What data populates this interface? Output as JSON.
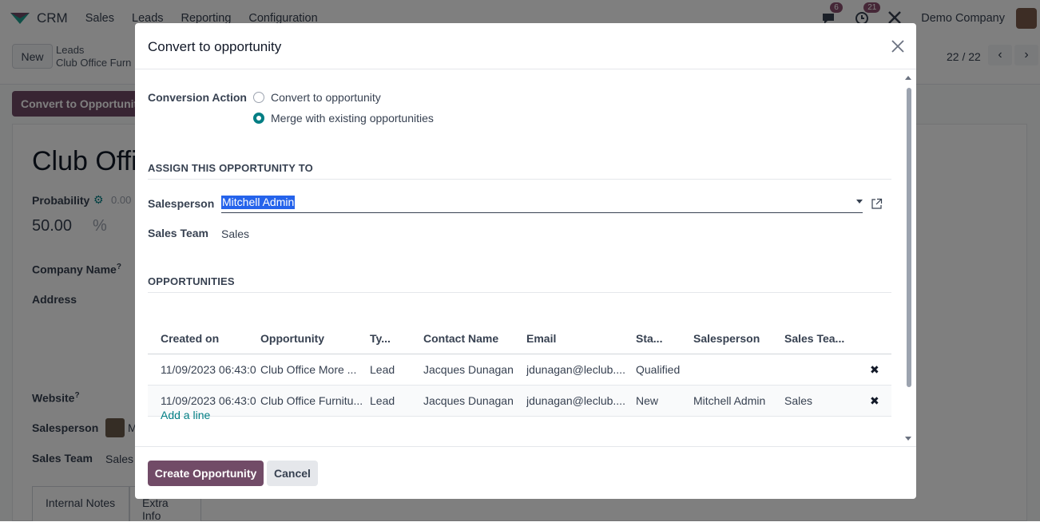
{
  "nav": {
    "app_name": "CRM",
    "menu": [
      "Sales",
      "Leads",
      "Reporting",
      "Configuration"
    ],
    "messages_count": "6",
    "activities_count": "21",
    "company": "Demo Company"
  },
  "control_panel": {
    "new_label": "New",
    "breadcrumb_parent": "Leads",
    "breadcrumb_current": "Club Office Furn",
    "pager": "22 / 22"
  },
  "form": {
    "convert_button": "Convert to Opportunit",
    "title": "Club Offi",
    "probability_label": "Probability",
    "probability_auto": "0.00",
    "probability_value": "50.00",
    "probability_unit": "%",
    "company_name_label": "Company Name",
    "address_label": "Address",
    "website_label": "Website",
    "help_mark": "?",
    "salesperson_label": "Salesperson",
    "salesperson_initial": "M",
    "sales_team_label": "Sales Team",
    "sales_team_value": "Sales",
    "tabs": [
      "Internal Notes",
      "Extra Info"
    ]
  },
  "dialog": {
    "title": "Convert to opportunity",
    "conversion_action_label": "Conversion Action",
    "options": [
      "Convert to opportunity",
      "Merge with existing opportunities"
    ],
    "selected_option": "Merge with existing opportunities",
    "assign_section": "ASSIGN THIS OPPORTUNITY TO",
    "salesperson_label": "Salesperson",
    "salesperson_value": "Mitchell Admin",
    "sales_team_label": "Sales Team",
    "sales_team_value": "Sales",
    "opportunities_section": "OPPORTUNITIES",
    "columns": [
      "Created on",
      "Opportunity",
      "Ty...",
      "Contact Name",
      "Email",
      "Sta...",
      "Salesperson",
      "Sales Tea..."
    ],
    "rows": [
      [
        "11/09/2023 06:43:0",
        "Club Office More ...",
        "Lead",
        "Jacques Dunagan",
        "jdunagan@leclub....",
        "Qualified",
        "",
        ""
      ],
      [
        "11/09/2023 06:43:0",
        "Club Office Furnitu...",
        "Lead",
        "Jacques Dunagan",
        "jdunagan@leclub....",
        "New",
        "Mitchell Admin",
        "Sales"
      ]
    ],
    "add_line": "Add a line",
    "create_button": "Create Opportunity",
    "cancel_button": "Cancel"
  },
  "colors": {
    "primary": "#714b67",
    "accent": "#017e84",
    "selection": "#2563eb"
  }
}
